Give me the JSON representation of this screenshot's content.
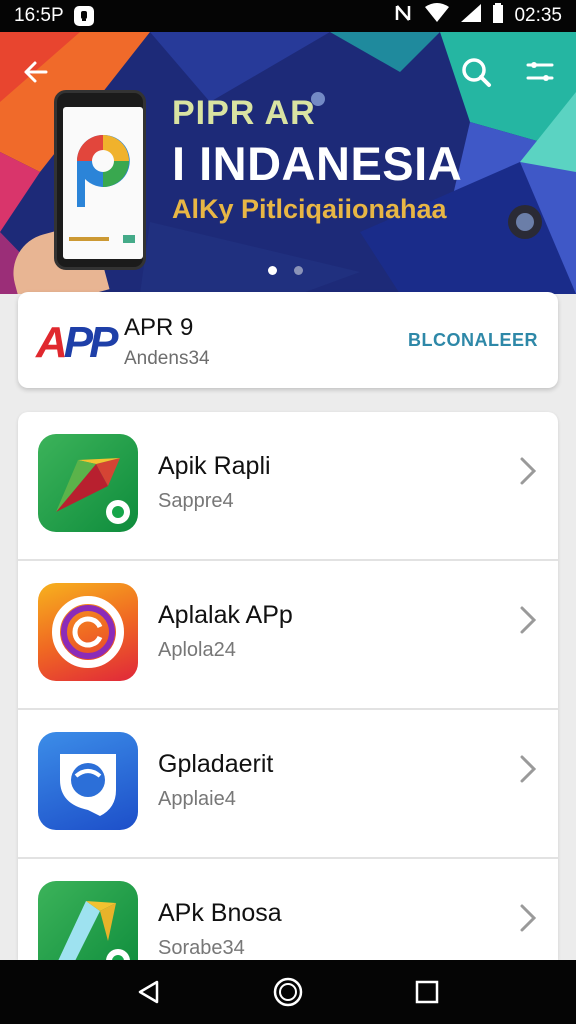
{
  "status_bar": {
    "time_left": "16:5P",
    "time_right": "02:35",
    "icons": [
      "notification-icon",
      "nfc-icon",
      "wifi-icon",
      "signal-icon",
      "battery-icon"
    ]
  },
  "hero": {
    "title_line1": "PIPR AR",
    "title_line2": "I INDANESIA",
    "title_line3": "AlKy Pitlciqaiionahaa",
    "icons": [
      "back-arrow-icon",
      "search-icon",
      "filter-icon"
    ],
    "carousel_dots": 2,
    "active_dot": 0
  },
  "featured": {
    "logo_text_a": "A",
    "logo_text_p": "PP",
    "title": "APR 9",
    "subtitle": "Andens34",
    "action_label": "BLCONALEER"
  },
  "apps": [
    {
      "name": "Apik Rapli",
      "subtitle": "Sappre4",
      "icon": "arrow-app-icon"
    },
    {
      "name": "Aplalak APp",
      "subtitle": "Aplola24",
      "icon": "ring-app-icon"
    },
    {
      "name": "Gpladaerit",
      "subtitle": "Applaie4",
      "icon": "shield-chat-app-icon"
    },
    {
      "name": "APk Bnosa",
      "subtitle": "Sorabe34",
      "icon": "pen-app-icon"
    }
  ],
  "nav": {
    "icons": [
      "back-triangle-icon",
      "home-circle-icon",
      "recents-square-icon"
    ]
  },
  "colors": {
    "accent_action": "#2e88a8",
    "status_bar_bg": "#050505",
    "hero_bg": "#1d2a78"
  }
}
